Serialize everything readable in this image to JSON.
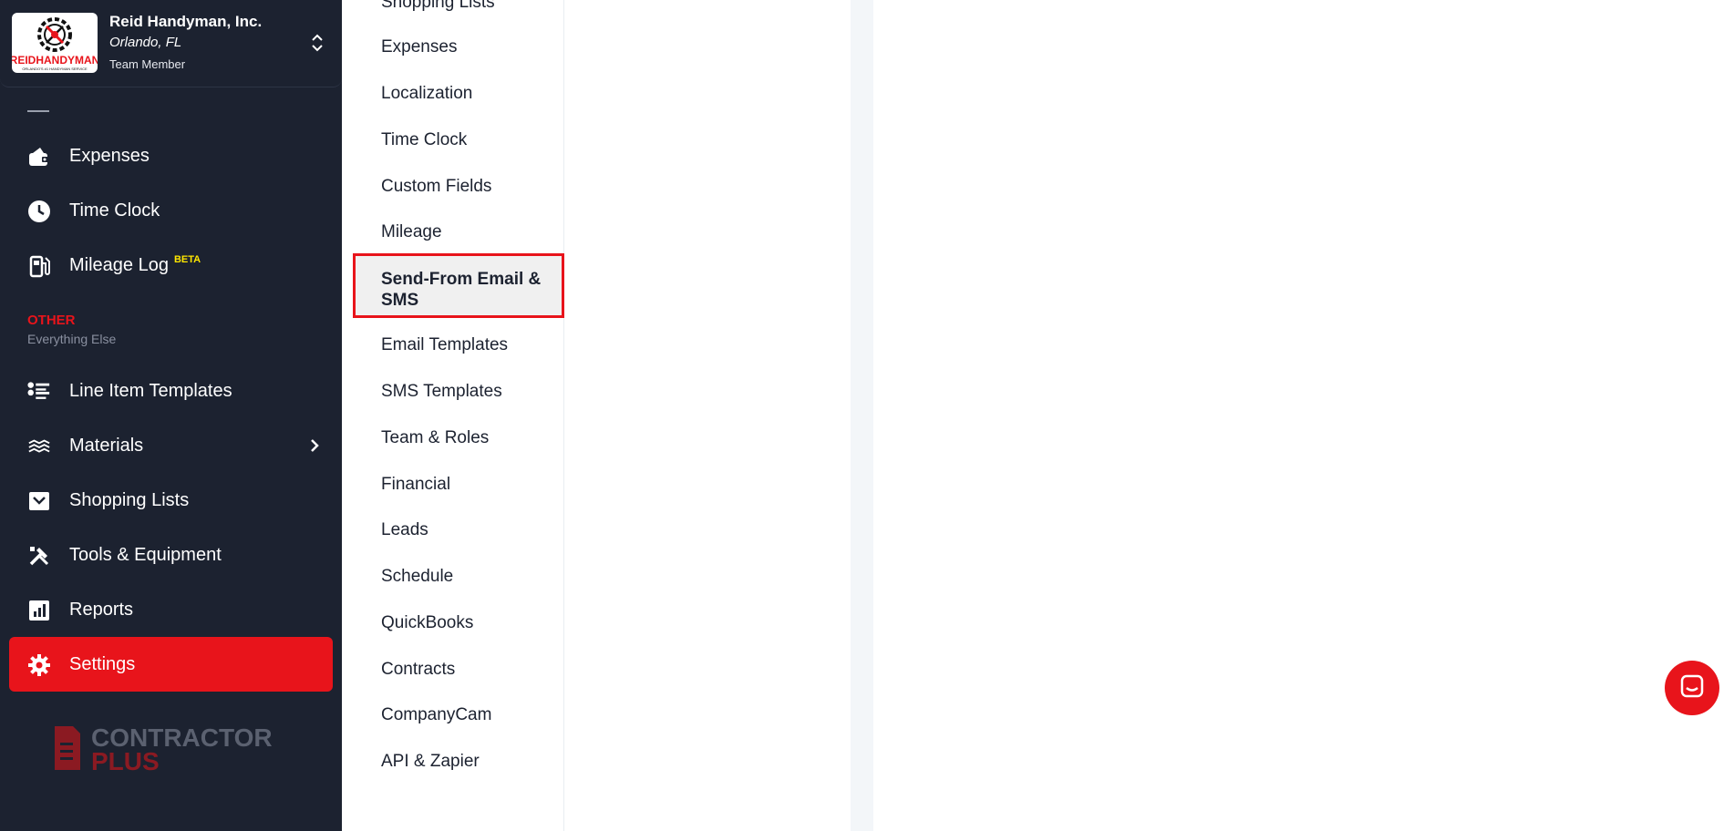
{
  "company": {
    "name": "Reid Handyman, Inc.",
    "location": "Orlando, FL",
    "role": "Team Member",
    "logo_text": "REIDHANDYMAN",
    "logo_tagline": "ORLANDO'S #1 HANDYMAN SERVICE"
  },
  "sidebar": {
    "items": [
      {
        "label": "Expenses",
        "icon": "wallet-icon"
      },
      {
        "label": "Time Clock",
        "icon": "clock-icon"
      },
      {
        "label": "Mileage Log",
        "badge": "BETA",
        "icon": "fuel-pump-icon"
      },
      {
        "label": "Line Item Templates",
        "icon": "list-icon"
      },
      {
        "label": "Materials",
        "icon": "materials-icon"
      },
      {
        "label": "Shopping Lists",
        "icon": "basket-icon"
      },
      {
        "label": "Tools & Equipment",
        "icon": "tools-icon"
      },
      {
        "label": "Reports",
        "icon": "chart-icon"
      },
      {
        "label": "Settings",
        "icon": "gear-icon"
      }
    ],
    "section_title": "OTHER",
    "section_subtitle": "Everything Else",
    "brand_logo_line1": "CONTRACTOR",
    "brand_logo_line2": "PLUS"
  },
  "settings_menu": {
    "items": [
      "Shopping Lists",
      "Expenses",
      "Localization",
      "Time Clock",
      "Custom Fields",
      "Mileage",
      "Send-From Email & SMS",
      "Email Templates",
      "SMS Templates",
      "Team & Roles",
      "Financial",
      "Leads",
      "Schedule",
      "QuickBooks",
      "Contracts",
      "CompanyCam",
      "API & Zapier"
    ],
    "selected": "Send-From Email & SMS"
  },
  "colors": {
    "sidebar_bg": "#1c2230",
    "accent": "#e8141b",
    "beta": "#ffe600"
  }
}
